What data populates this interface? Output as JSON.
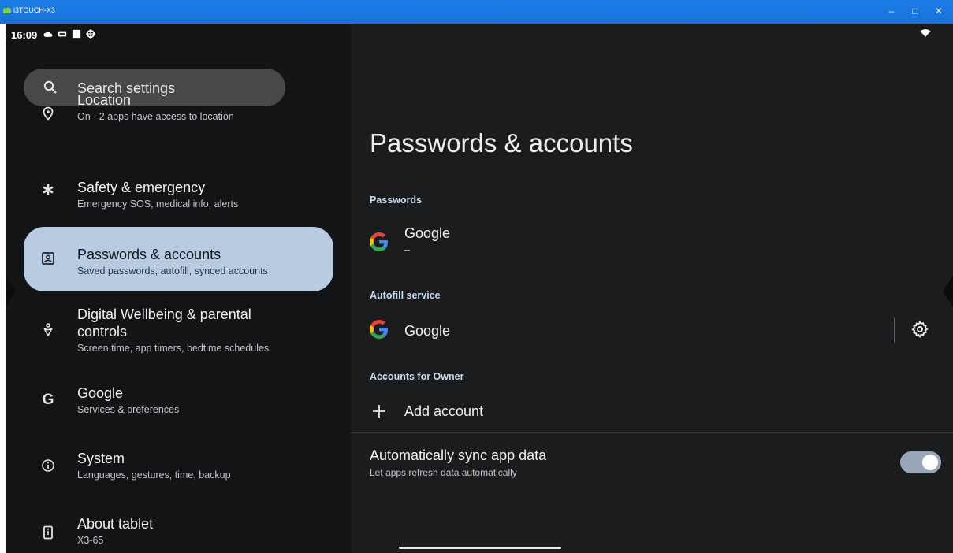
{
  "window": {
    "title": "i3TOUCH-X3",
    "minimize": "–",
    "maximize": "□",
    "close": "✕"
  },
  "statusbar": {
    "time": "16:09",
    "icons": [
      "cloud-icon",
      "dvr-icon",
      "square-icon",
      "settings-gear-icon"
    ],
    "wifi": "wifi-icon"
  },
  "search": {
    "placeholder": "Search settings"
  },
  "sidebar": {
    "items": [
      {
        "title": "Location",
        "subtitle": "On - 2 apps have access to location",
        "icon": "location-pin-icon"
      },
      {
        "title": "Safety & emergency",
        "subtitle": "Emergency SOS, medical info, alerts",
        "icon": "asterisk-icon"
      },
      {
        "title": "Passwords & accounts",
        "subtitle": "Saved passwords, autofill, synced accounts",
        "icon": "account-box-icon",
        "selected": true
      },
      {
        "title": "Digital Wellbeing & parental",
        "title_line2": "controls",
        "subtitle": "Screen time, app timers, bedtime schedules",
        "icon": "wellbeing-icon"
      },
      {
        "title": "Google",
        "subtitle": "Services & preferences",
        "icon": "google-g-icon"
      },
      {
        "title": "System",
        "subtitle": "Languages, gestures, time, backup",
        "icon": "info-icon"
      },
      {
        "title": "About tablet",
        "subtitle": "X3-65",
        "icon": "tablet-icon"
      }
    ]
  },
  "main": {
    "title": "Passwords & accounts",
    "passwords_section": "Passwords",
    "passwords_item": {
      "title": "Google",
      "subtitle": "–"
    },
    "autofill_section": "Autofill service",
    "autofill_item": {
      "title": "Google"
    },
    "accounts_section": "Accounts for Owner",
    "add_account": "Add account",
    "sync": {
      "title": "Automatically sync app data",
      "subtitle": "Let apps refresh data automatically",
      "enabled": true
    }
  },
  "colors": {
    "selected_bg": "#b8cbe0",
    "section_accent": "#c8dcf2",
    "toggle_on": "#9aa7b8",
    "google_blue": "#4285F4",
    "google_red": "#EA4335",
    "google_yellow": "#FBBC05",
    "google_green": "#34A853"
  }
}
